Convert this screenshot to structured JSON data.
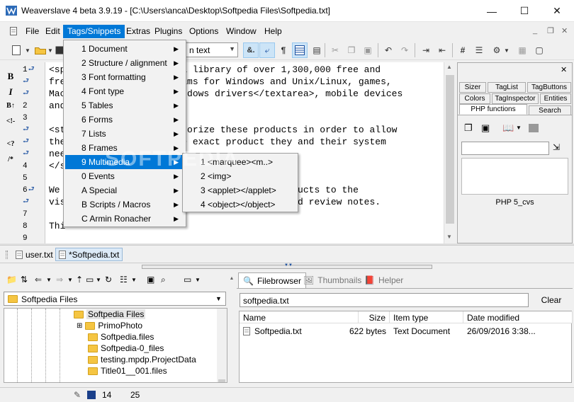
{
  "window": {
    "title": "Weaverslave 4 beta 3.9.19 - [C:\\Users\\anca\\Desktop\\Softpedia Files\\Softpedia.txt]",
    "minimize": "—",
    "maximize": "☐",
    "close": "✕"
  },
  "menubar": [
    "File",
    "Edit",
    "Tags/Snippets",
    "Extras",
    "Plugins",
    "Options",
    "Window",
    "Help"
  ],
  "mdi_controls": [
    "_",
    "❐",
    "✕"
  ],
  "toolbar": {
    "view_combo": "n text"
  },
  "left_tools": [
    "B",
    "I",
    "B↑",
    "<!-",
    "<?",
    "/*"
  ],
  "gutter": [
    "1",
    "2",
    "3",
    "4",
    "5",
    "6",
    "7",
    "8",
    "9"
  ],
  "editor_lines": [
    {
      "row": 0,
      "text": "<sp                   s a library of over 1,300,000 free and"
    },
    {
      "row": 1,
      "text": "fre                   grams for Windows and Unix/Linux, games,"
    },
    {
      "row": 2,
      "text": "Mac                   Windows drivers</textarea>, mobile devices"
    },
    {
      "row": 3,
      "text": "and"
    },
    {
      "row": 5,
      "text": "<st                   tegorize these products in order to allow"
    },
    {
      "row": 6,
      "text": "the                   the exact product they and their system"
    },
    {
      "row": 7,
      "text": "nee"
    },
    {
      "row": 8,
      "text": "</s"
    },
    {
      "row": 10,
      "text": "We                                     t products to the"
    },
    {
      "row": 11,
      "text": "vis                                    ion and review notes."
    },
    {
      "row": 13,
      "text": "Thi"
    }
  ],
  "wrap_rows": [
    0,
    1,
    2,
    5,
    6,
    7,
    10,
    11
  ],
  "number_rows": [
    {
      "row": 0,
      "num": "1"
    },
    {
      "row": 3,
      "num": "2"
    },
    {
      "row": 4,
      "num": "3"
    },
    {
      "row": 8,
      "num": "4"
    },
    {
      "row": 9,
      "num": "5"
    },
    {
      "row": 10,
      "num": "6"
    },
    {
      "row": 12,
      "num": "7"
    },
    {
      "row": 13,
      "num": "8"
    },
    {
      "row": 14,
      "num": "9"
    }
  ],
  "right_panel": {
    "close": "✕",
    "tabs_row1": [
      "Sizer",
      "TagList",
      "TagButtons"
    ],
    "tabs_row2": [
      "Colors",
      "TagInspector",
      "Entities"
    ],
    "tabs_row3": [
      "PHP functions",
      "Search"
    ],
    "label": "PHP 5_cvs"
  },
  "file_tabs": [
    "user.txt",
    "*Softpedia.txt"
  ],
  "tags_menu": [
    "1 Document",
    "2 Structure / alignment",
    "3 Font formatting",
    "4 Font type",
    "5 Tables",
    "6 Forms",
    "7 Lists",
    "8 Frames",
    "9 Multimedia",
    "0 Events",
    "A Special",
    "B Scripts / Macros",
    "C Armin Ronacher"
  ],
  "multimedia_menu": [
    "1 <marquee><m..>",
    "2 <img>",
    "3 <applet></applet>",
    "4 <object></object>"
  ],
  "watermark": "SOFTPEDIA",
  "folder_combo": "Softpedia Files",
  "tree": [
    {
      "label": "Softpedia Files",
      "kind": "folder",
      "selected": true
    },
    {
      "label": "PrimoPhoto",
      "kind": "folder",
      "expander": "+"
    },
    {
      "label": "Softpedia.files",
      "kind": "folder"
    },
    {
      "label": "Softpedia-0_files",
      "kind": "folder"
    },
    {
      "label": "testing.mpdp.ProjectData",
      "kind": "folder"
    },
    {
      "label": "Title01__001.files",
      "kind": "folder"
    }
  ],
  "bottom_tabs": [
    "Filebrowser",
    "Thumbnails",
    "Helper"
  ],
  "path_box": "softpedia.txt",
  "clear_button": "Clear",
  "file_columns": [
    "Name",
    "Size",
    "Item type",
    "Date modified"
  ],
  "file_rows": [
    {
      "name": "Softpedia.txt",
      "size": "622 bytes",
      "type": "Text Document",
      "date": "26/09/2016 3:38..."
    }
  ],
  "status": {
    "line": "14",
    "col": "25"
  }
}
